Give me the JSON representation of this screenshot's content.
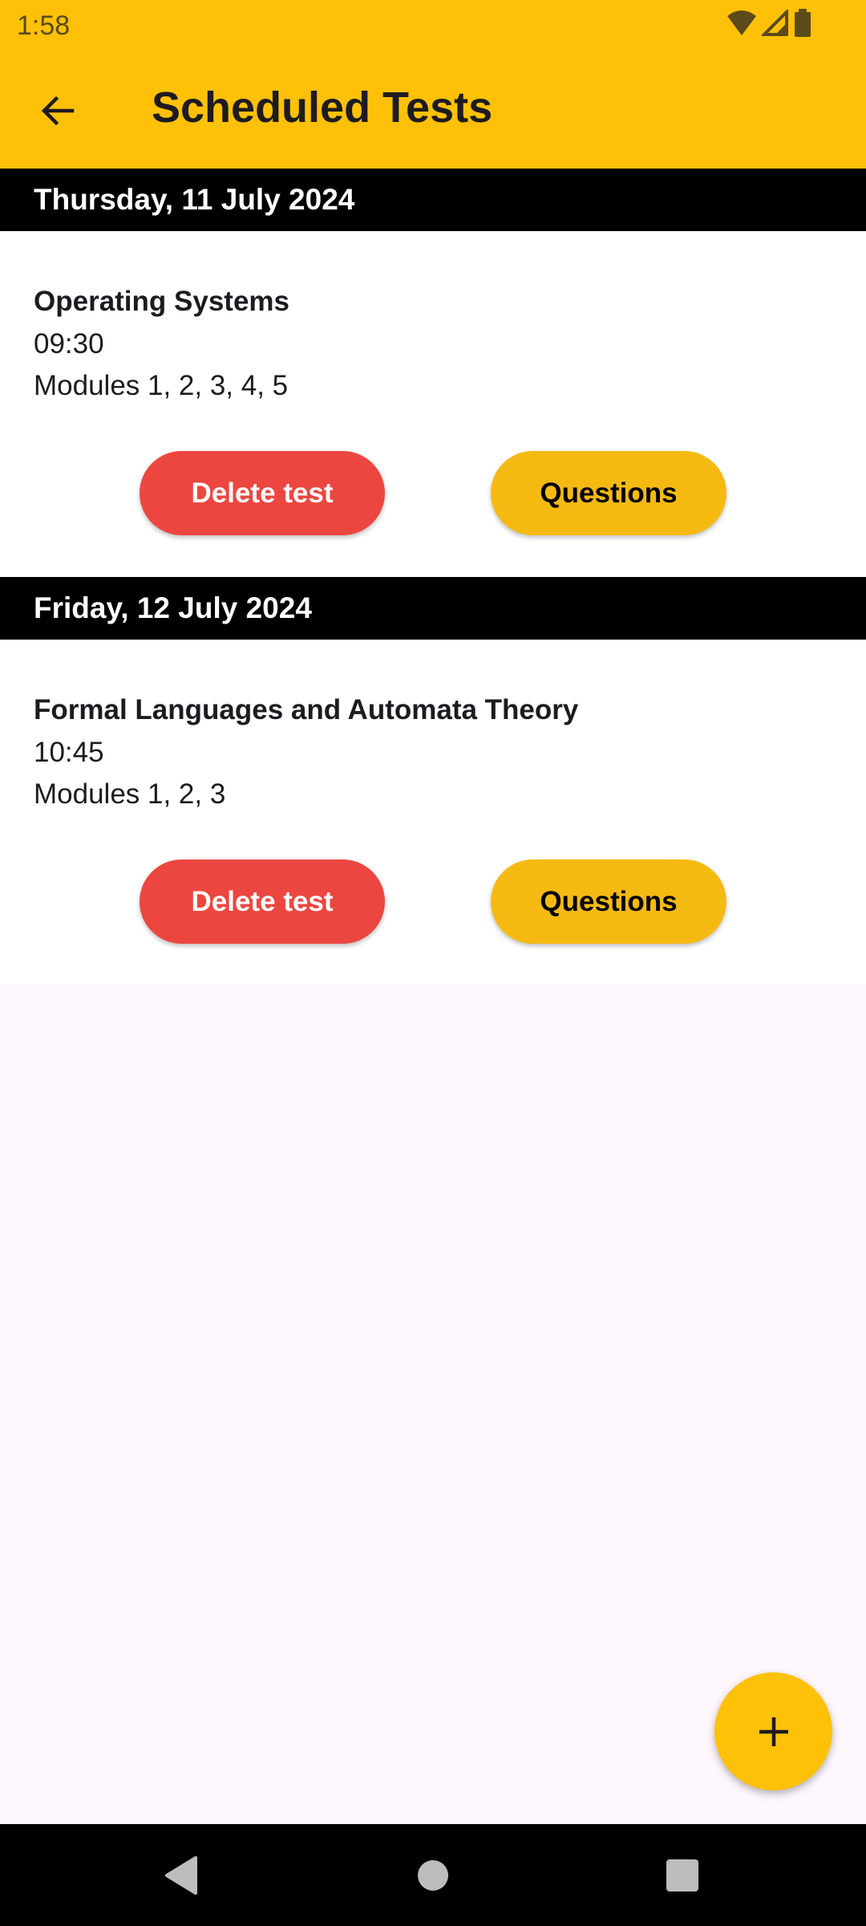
{
  "status_bar": {
    "time": "1:58",
    "icons": [
      "wifi-icon",
      "cell-signal-icon",
      "battery-icon"
    ]
  },
  "app_bar": {
    "title": "Scheduled Tests",
    "back_icon": "arrow-back-icon",
    "color": "#FFC107"
  },
  "sections": [
    {
      "date": "Thursday, 11 July 2024",
      "test": {
        "subject": "Operating Systems",
        "time": "09:30",
        "modules": "Modules 1, 2, 3, 4, 5",
        "delete_label": "Delete test",
        "questions_label": "Questions"
      }
    },
    {
      "date": "Friday, 12 July 2024",
      "test": {
        "subject": "Formal Languages and Automata Theory",
        "time": "10:45",
        "modules": "Modules 1, 2, 3",
        "delete_label": "Delete test",
        "questions_label": "Questions"
      }
    }
  ],
  "fab": {
    "icon": "plus-icon"
  },
  "nav_bar": {
    "icons": [
      "back-triangle-icon",
      "home-circle-icon",
      "recents-square-icon"
    ]
  },
  "colors": {
    "accent": "#FFC107",
    "delete_button": "#EC4640",
    "questions_button": "#F5BA12",
    "date_header": "#000000",
    "background": "#FEF7FD"
  }
}
